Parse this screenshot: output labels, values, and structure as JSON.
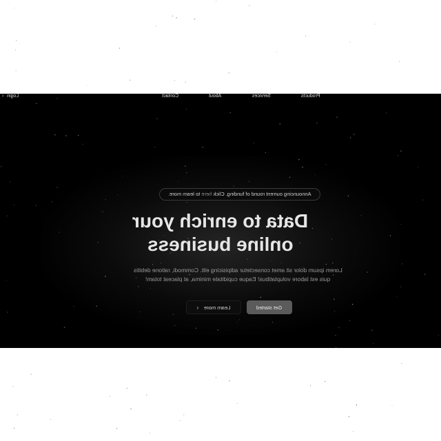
{
  "nav": {
    "links": [
      "Products",
      "Services",
      "About",
      "Contact"
    ],
    "login_label": "Login",
    "login_arrow": "›"
  },
  "announcement": {
    "prefix": "Announcing ourrent round of funding. Click ",
    "link_text": "here",
    "suffix": " to learn more."
  },
  "hero": {
    "headline_line1": "Data to enrich your",
    "headline_line2": "online business",
    "subtext_line1": "Lorem ipsum dolor sit amet consectetur adipisicing elit. Commodi, ratione debitis",
    "subtext_line2": "quis est labore voluptatibus! Eaque cupiditate minima, at placeat totam!"
  },
  "cta": {
    "primary_label": "Get started",
    "secondary_label": "Learn more",
    "secondary_arrow": "›"
  },
  "colors": {
    "hero_background": "#000000",
    "page_background": "#ffffff",
    "primary_button": "#5b5b5b",
    "headline_text": "#e6e6e6"
  }
}
